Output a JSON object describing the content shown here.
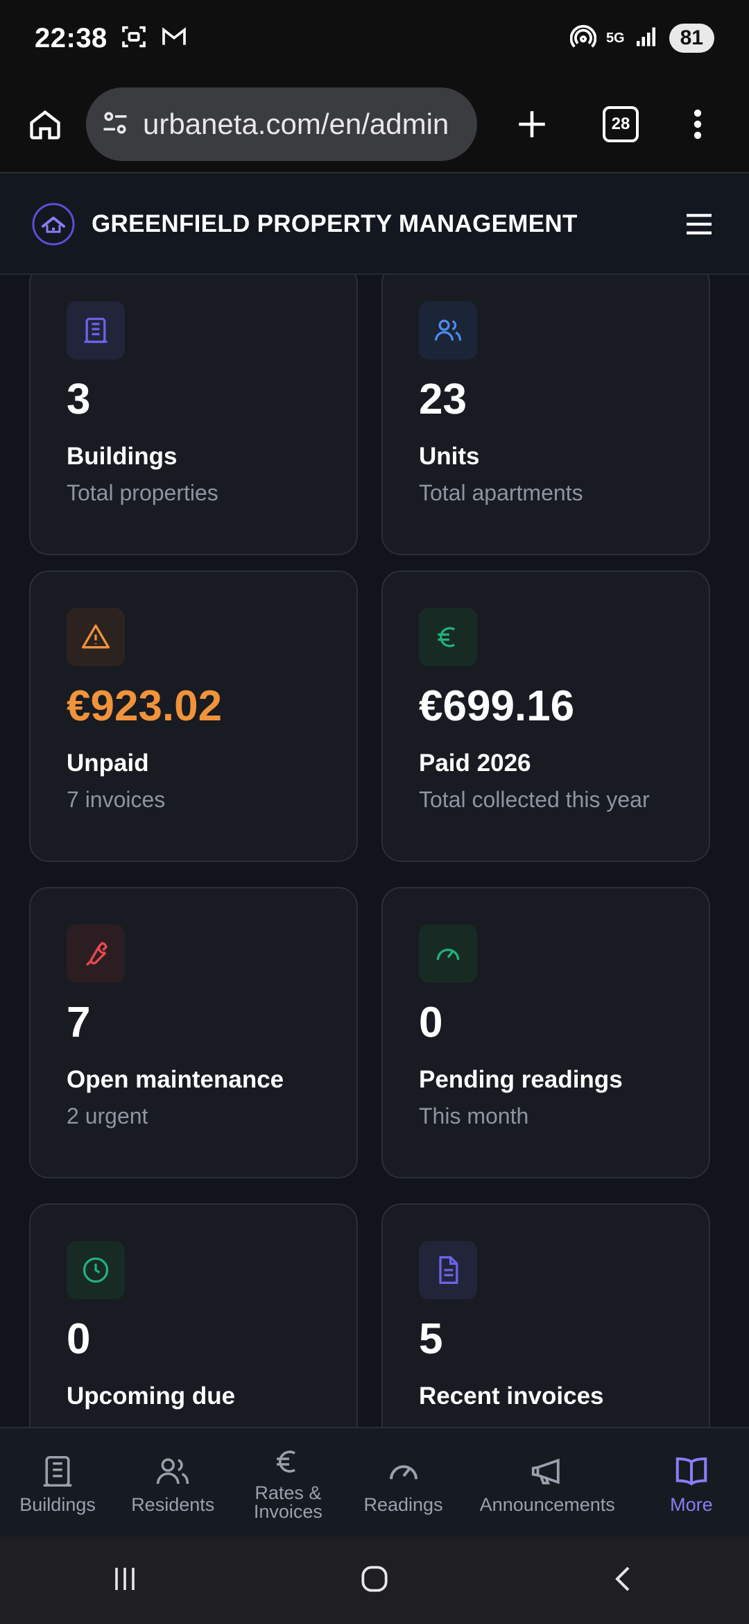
{
  "status_bar": {
    "time": "22:38",
    "battery": "81",
    "network": "5G"
  },
  "browser": {
    "url": "urbaneta.com/en/admin",
    "tab_count": "28"
  },
  "header": {
    "org_name": "GREENFIELD PROPERTY MANAGEMENT"
  },
  "cards": [
    {
      "value": "3",
      "label": "Buildings",
      "sub": "Total properties",
      "icon": "building-icon",
      "color": "#6b63e8",
      "bg": "#22243a"
    },
    {
      "value": "23",
      "label": "Units",
      "sub": "Total apartments",
      "icon": "users-icon",
      "color": "#4f8bf0",
      "bg": "#1b2537"
    },
    {
      "value": "€923.02",
      "label": "Unpaid",
      "sub": "7 invoices",
      "icon": "warning-icon",
      "color": "#f0933a",
      "bg": "#2c2320",
      "value_color": "#f0933a"
    },
    {
      "value": "€699.16",
      "label": "Paid 2026",
      "sub": "Total collected this year",
      "icon": "euro-icon",
      "color": "#22b07a",
      "bg": "#172a24"
    },
    {
      "value": "7",
      "label": "Open maintenance",
      "sub": "2 urgent",
      "icon": "wrench-icon",
      "color": "#e8494f",
      "bg": "#2c1d22"
    },
    {
      "value": "0",
      "label": "Pending readings",
      "sub": "This month",
      "icon": "gauge-icon",
      "color": "#22b07a",
      "bg": "#172a24"
    },
    {
      "value": "0",
      "label": "Upcoming due",
      "sub": "",
      "icon": "clock-icon",
      "color": "#22b07a",
      "bg": "#172a24"
    },
    {
      "value": "5",
      "label": "Recent invoices",
      "sub": "",
      "icon": "document-icon",
      "color": "#6b63e8",
      "bg": "#22243a"
    }
  ],
  "bottom_nav": [
    {
      "label": "Buildings",
      "icon": "building-icon"
    },
    {
      "label": "Residents",
      "icon": "users-icon"
    },
    {
      "label": "Rates &\nInvoices",
      "icon": "euro-icon"
    },
    {
      "label": "Readings",
      "icon": "gauge-icon"
    },
    {
      "label": "Announcements",
      "icon": "megaphone-icon"
    },
    {
      "label": "More",
      "icon": "book-icon",
      "active": true
    }
  ],
  "colors": {
    "accent": "#8b7cf6",
    "background": "#11141a",
    "card": "#181b22",
    "muted": "#8e95a1"
  }
}
